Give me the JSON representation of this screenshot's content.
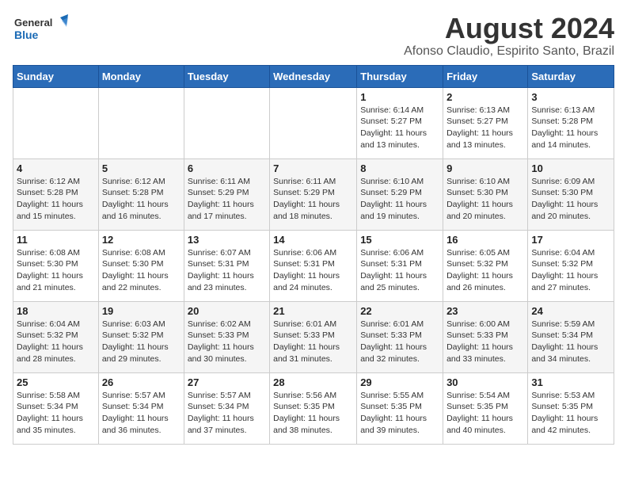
{
  "header": {
    "logo_line1": "General",
    "logo_line2": "Blue",
    "month_title": "August 2024",
    "subtitle": "Afonso Claudio, Espirito Santo, Brazil"
  },
  "weekdays": [
    "Sunday",
    "Monday",
    "Tuesday",
    "Wednesday",
    "Thursday",
    "Friday",
    "Saturday"
  ],
  "weeks": [
    [
      {
        "day": "",
        "info": ""
      },
      {
        "day": "",
        "info": ""
      },
      {
        "day": "",
        "info": ""
      },
      {
        "day": "",
        "info": ""
      },
      {
        "day": "1",
        "info": "Sunrise: 6:14 AM\nSunset: 5:27 PM\nDaylight: 11 hours\nand 13 minutes."
      },
      {
        "day": "2",
        "info": "Sunrise: 6:13 AM\nSunset: 5:27 PM\nDaylight: 11 hours\nand 13 minutes."
      },
      {
        "day": "3",
        "info": "Sunrise: 6:13 AM\nSunset: 5:28 PM\nDaylight: 11 hours\nand 14 minutes."
      }
    ],
    [
      {
        "day": "4",
        "info": "Sunrise: 6:12 AM\nSunset: 5:28 PM\nDaylight: 11 hours\nand 15 minutes."
      },
      {
        "day": "5",
        "info": "Sunrise: 6:12 AM\nSunset: 5:28 PM\nDaylight: 11 hours\nand 16 minutes."
      },
      {
        "day": "6",
        "info": "Sunrise: 6:11 AM\nSunset: 5:29 PM\nDaylight: 11 hours\nand 17 minutes."
      },
      {
        "day": "7",
        "info": "Sunrise: 6:11 AM\nSunset: 5:29 PM\nDaylight: 11 hours\nand 18 minutes."
      },
      {
        "day": "8",
        "info": "Sunrise: 6:10 AM\nSunset: 5:29 PM\nDaylight: 11 hours\nand 19 minutes."
      },
      {
        "day": "9",
        "info": "Sunrise: 6:10 AM\nSunset: 5:30 PM\nDaylight: 11 hours\nand 20 minutes."
      },
      {
        "day": "10",
        "info": "Sunrise: 6:09 AM\nSunset: 5:30 PM\nDaylight: 11 hours\nand 20 minutes."
      }
    ],
    [
      {
        "day": "11",
        "info": "Sunrise: 6:08 AM\nSunset: 5:30 PM\nDaylight: 11 hours\nand 21 minutes."
      },
      {
        "day": "12",
        "info": "Sunrise: 6:08 AM\nSunset: 5:30 PM\nDaylight: 11 hours\nand 22 minutes."
      },
      {
        "day": "13",
        "info": "Sunrise: 6:07 AM\nSunset: 5:31 PM\nDaylight: 11 hours\nand 23 minutes."
      },
      {
        "day": "14",
        "info": "Sunrise: 6:06 AM\nSunset: 5:31 PM\nDaylight: 11 hours\nand 24 minutes."
      },
      {
        "day": "15",
        "info": "Sunrise: 6:06 AM\nSunset: 5:31 PM\nDaylight: 11 hours\nand 25 minutes."
      },
      {
        "day": "16",
        "info": "Sunrise: 6:05 AM\nSunset: 5:32 PM\nDaylight: 11 hours\nand 26 minutes."
      },
      {
        "day": "17",
        "info": "Sunrise: 6:04 AM\nSunset: 5:32 PM\nDaylight: 11 hours\nand 27 minutes."
      }
    ],
    [
      {
        "day": "18",
        "info": "Sunrise: 6:04 AM\nSunset: 5:32 PM\nDaylight: 11 hours\nand 28 minutes."
      },
      {
        "day": "19",
        "info": "Sunrise: 6:03 AM\nSunset: 5:32 PM\nDaylight: 11 hours\nand 29 minutes."
      },
      {
        "day": "20",
        "info": "Sunrise: 6:02 AM\nSunset: 5:33 PM\nDaylight: 11 hours\nand 30 minutes."
      },
      {
        "day": "21",
        "info": "Sunrise: 6:01 AM\nSunset: 5:33 PM\nDaylight: 11 hours\nand 31 minutes."
      },
      {
        "day": "22",
        "info": "Sunrise: 6:01 AM\nSunset: 5:33 PM\nDaylight: 11 hours\nand 32 minutes."
      },
      {
        "day": "23",
        "info": "Sunrise: 6:00 AM\nSunset: 5:33 PM\nDaylight: 11 hours\nand 33 minutes."
      },
      {
        "day": "24",
        "info": "Sunrise: 5:59 AM\nSunset: 5:34 PM\nDaylight: 11 hours\nand 34 minutes."
      }
    ],
    [
      {
        "day": "25",
        "info": "Sunrise: 5:58 AM\nSunset: 5:34 PM\nDaylight: 11 hours\nand 35 minutes."
      },
      {
        "day": "26",
        "info": "Sunrise: 5:57 AM\nSunset: 5:34 PM\nDaylight: 11 hours\nand 36 minutes."
      },
      {
        "day": "27",
        "info": "Sunrise: 5:57 AM\nSunset: 5:34 PM\nDaylight: 11 hours\nand 37 minutes."
      },
      {
        "day": "28",
        "info": "Sunrise: 5:56 AM\nSunset: 5:35 PM\nDaylight: 11 hours\nand 38 minutes."
      },
      {
        "day": "29",
        "info": "Sunrise: 5:55 AM\nSunset: 5:35 PM\nDaylight: 11 hours\nand 39 minutes."
      },
      {
        "day": "30",
        "info": "Sunrise: 5:54 AM\nSunset: 5:35 PM\nDaylight: 11 hours\nand 40 minutes."
      },
      {
        "day": "31",
        "info": "Sunrise: 5:53 AM\nSunset: 5:35 PM\nDaylight: 11 hours\nand 42 minutes."
      }
    ]
  ]
}
